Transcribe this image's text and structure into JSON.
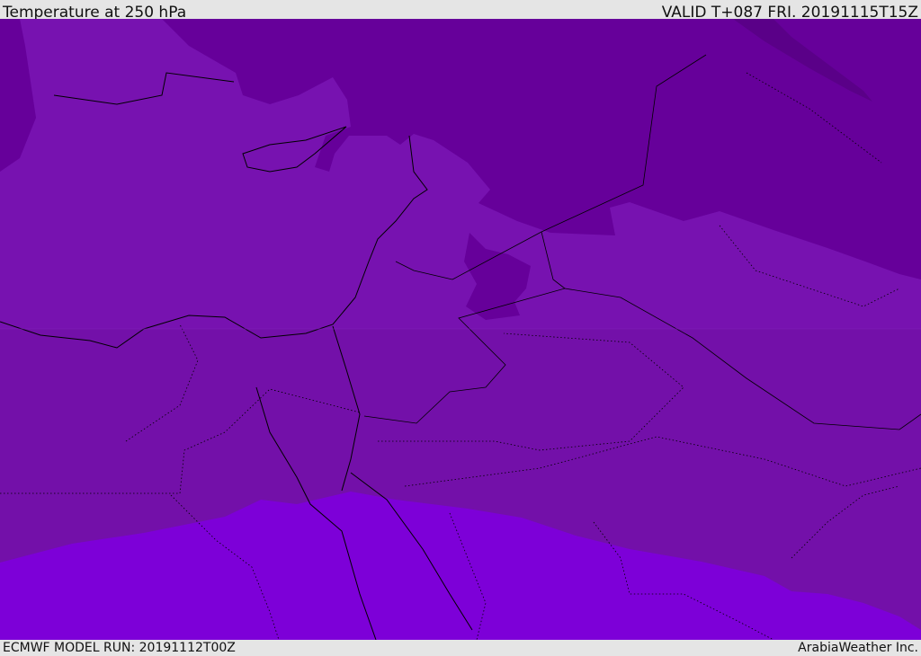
{
  "header": {
    "title": "Temperature at 250 hPa",
    "valid": "VALID T+087 FRI. 20191115T15Z"
  },
  "footer": {
    "model_run": "ECMWF MODEL RUN: 20191112T00Z",
    "credit": "ArabiaWeather Inc."
  },
  "colors": {
    "base": "#7712b0",
    "dark": "#66009a",
    "darker": "#5a0088",
    "bright": "#7d00d8",
    "border": "#000000"
  }
}
